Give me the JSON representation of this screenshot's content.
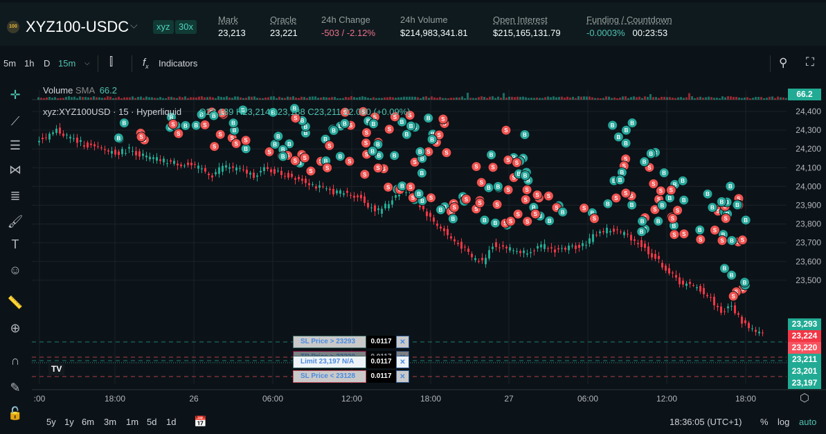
{
  "header": {
    "logo": "100",
    "pair": "XYZ100-USDC",
    "badges": [
      "xyz",
      "30x"
    ],
    "stats": [
      {
        "label": "Mark",
        "value": "23,213"
      },
      {
        "label": "Oracle",
        "value": "23,221"
      },
      {
        "label": "24h Change",
        "value": "-503 / -2.12%"
      },
      {
        "label": "24h Volume",
        "value": "$214,983,341.81"
      },
      {
        "label": "Open Interest",
        "value": "$215,165,131.79"
      },
      {
        "label": "Funding / Countdown",
        "value": "-0.0003%",
        "value2": "00:23:53"
      }
    ]
  },
  "toolbar": {
    "intervals": [
      "5m",
      "1h",
      "D",
      "15m"
    ],
    "indicators": "Indicators"
  },
  "legend": {
    "volume": "Volume",
    "sma": "SMA",
    "sma_val": "66.2",
    "symbol": "xyz:XYZ100USD · 15 · Hyperliquid",
    "ohlc": "O23,189 H23,214 L23,188 C23,211 22.000 (+0.09%)"
  },
  "orders": [
    {
      "label": "SL Price > 23293",
      "qty": "0.0117"
    },
    {
      "label": "TP Price > 23220",
      "qty": "0.0117"
    },
    {
      "label": "Limit 23,197 N/A",
      "qty": "0.0117"
    },
    {
      "label": "SL Price < 23128",
      "qty": "0.0117"
    }
  ],
  "price_badges": [
    {
      "text": "66.2",
      "color": "#22ab94"
    },
    {
      "text": "23,293",
      "color": "#22ab94"
    },
    {
      "text": "23,224",
      "color": "#f23645"
    },
    {
      "text": "23,220",
      "color": "#f7525f"
    },
    {
      "text": "23,211",
      "color": "#22ab94"
    },
    {
      "text": "23,201",
      "color": "#22ab94"
    },
    {
      "text": "23,197",
      "color": "#22ab94"
    }
  ],
  "chart_data": {
    "type": "candlestick",
    "ylim": [
      23150,
      24450
    ],
    "yticks": [
      "24,400",
      "24,300",
      "24,200",
      "24,100",
      "24,000",
      "23,900",
      "23,800",
      "23,700",
      "23,600",
      "23,500"
    ],
    "xticks": [
      ":00",
      "18:00",
      "26",
      "06:00",
      "12:00",
      "18:00",
      "27",
      "06:00",
      "12:00",
      "18:00"
    ],
    "closes": [
      24250,
      24300,
      24270,
      24240,
      24220,
      24200,
      24190,
      24180,
      24200,
      24170,
      24150,
      24140,
      24130,
      24120,
      24110,
      24090,
      24060,
      24110,
      24100,
      24080,
      24060,
      24090,
      24080,
      24060,
      24050,
      24030,
      24000,
      23980,
      23970,
      23960,
      23950,
      23900,
      23870,
      23910,
      23980,
      23970,
      23900,
      23830,
      23780,
      23720,
      23680,
      23620,
      23600,
      23690,
      23680,
      23660,
      23650,
      23670,
      23680,
      23660,
      23670,
      23680,
      23700,
      23750,
      23770,
      23760,
      23740,
      23700,
      23650,
      23600,
      23540,
      23490,
      23470,
      23450,
      23400,
      23330,
      23360,
      23280,
      23240,
      23211
    ],
    "trade_clusters": [
      [
        9,
        24230,
        24420
      ],
      [
        14,
        24220,
        24430
      ],
      [
        17,
        24200,
        24440
      ],
      [
        20,
        24200,
        24420
      ],
      [
        23,
        24150,
        24420
      ],
      [
        26,
        24080,
        24420
      ],
      [
        29,
        24030,
        24400
      ],
      [
        32,
        24010,
        24420
      ],
      [
        35,
        23920,
        24400
      ],
      [
        38,
        23870,
        24380
      ],
      [
        40,
        23800,
        24000
      ],
      [
        43,
        23800,
        24180
      ],
      [
        46,
        23780,
        24300
      ],
      [
        48,
        23800,
        24100
      ],
      [
        50,
        23820,
        23900
      ],
      [
        53,
        23820,
        23900
      ],
      [
        56,
        23900,
        24350
      ],
      [
        59,
        23750,
        24200
      ],
      [
        61,
        23680,
        24050
      ],
      [
        65,
        23700,
        24000
      ],
      [
        67,
        23380,
        24020
      ]
    ]
  },
  "bottom": {
    "ranges": [
      "5y",
      "1y",
      "6m",
      "3m",
      "1m",
      "5d",
      "1d"
    ],
    "time": "18:36:05 (UTC+1)",
    "pct": "%",
    "log": "log",
    "auto": "auto"
  }
}
